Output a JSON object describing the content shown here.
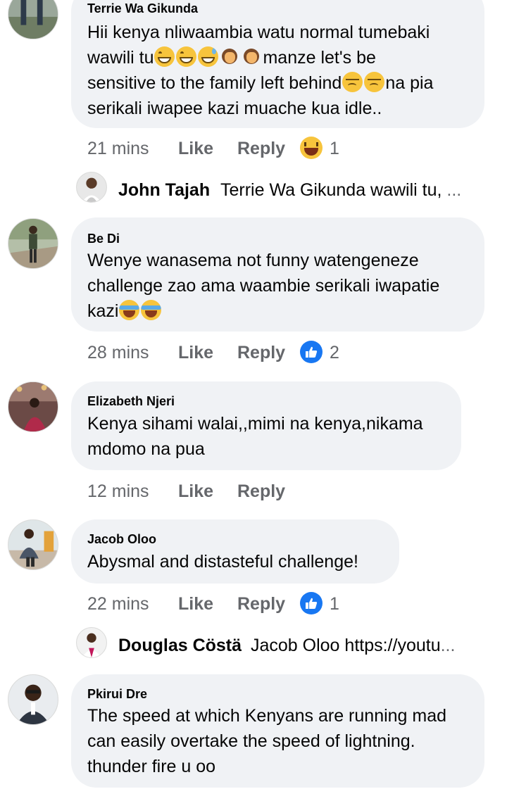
{
  "comments": [
    {
      "author": "Terrie Wa Gikunda",
      "lines": [
        [
          "Hii kenya nliwaambia watu normal tumebaki"
        ],
        [
          "wawili tu",
          "emo:grin",
          "emo:grin",
          "emo:sweat",
          "emo:facepalm",
          "emo:facepalm",
          "manze let's be"
        ],
        [
          "sensitive to the family left behind",
          "emo:disappoint",
          "emo:disappoint",
          "na pia"
        ],
        [
          "serikali iwapee kazi muache kua idle.."
        ]
      ],
      "time": "21 mins",
      "like_label": "Like",
      "reply_label": "Reply",
      "reaction": "haha-icon",
      "reaction_count": "1",
      "reply_preview": {
        "name": "John Tajah",
        "text": "Terrie Wa Gikunda wawili tu,",
        "ellipsis": "..."
      }
    },
    {
      "author": "Be Di",
      "lines": [
        [
          "Wenye wanasema not funny watengeneze"
        ],
        [
          "challenge zao ama waambie serikali iwapatie"
        ],
        [
          "kazi",
          "emo:crylaugh",
          "emo:crylaugh"
        ]
      ],
      "time": "28 mins",
      "like_label": "Like",
      "reply_label": "Reply",
      "reaction": "like-icon",
      "reaction_count": "2"
    },
    {
      "author": "Elizabeth Njeri",
      "lines": [
        [
          "Kenya sihami walai,,mimi na kenya,nikama"
        ],
        [
          "mdomo na pua"
        ]
      ],
      "time": "12 mins",
      "like_label": "Like",
      "reply_label": "Reply"
    },
    {
      "author": "Jacob Oloo",
      "lines": [
        [
          "Abysmal and distasteful challenge!"
        ]
      ],
      "time": "22 mins",
      "like_label": "Like",
      "reply_label": "Reply",
      "reaction": "like-icon",
      "reaction_count": "1",
      "reply_preview": {
        "name": "Douglas Cöstä",
        "text": "Jacob Oloo https://youtu",
        "ellipsis": "..."
      }
    },
    {
      "author": "Pkirui Dre",
      "lines": [
        [
          "The speed at which Kenyans are running mad"
        ],
        [
          "can easily overtake the speed of lightning."
        ],
        [
          "thunder fire u oo"
        ]
      ]
    }
  ],
  "colors": {
    "bubble": "#f0f2f5",
    "meta": "#65676b",
    "like_blue": "#1877f2"
  }
}
